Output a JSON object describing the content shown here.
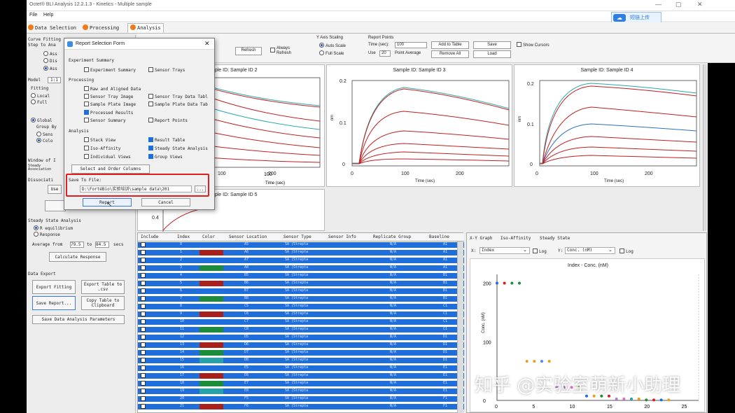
{
  "window": {
    "title": "Octet® BLI Analysis 12.2.1.3 - Kinetics - Multiple sample",
    "controls": [
      "—",
      "▢",
      "✕"
    ]
  },
  "menu": [
    "File",
    "Help"
  ],
  "cloud_button": {
    "label": "短链上传"
  },
  "tabs": [
    "Data Selection",
    "Processing",
    "Analysis"
  ],
  "left_panel": {
    "curve_fitting": "Curve Fitting",
    "step_to_analyze": "Step to Ana",
    "step_options": [
      "Ass",
      "Dis",
      "Ass"
    ],
    "model_label": "Model",
    "model_value": "1:1",
    "fitting_label": "Fitting",
    "fitting_options": [
      "Local",
      "Full"
    ],
    "global_label": "Global",
    "group_by": "Group By",
    "group_options": [
      "Sens",
      "Colo"
    ],
    "window_label": "Window of I",
    "steady_label": "Steady Association",
    "dissociation": "Dissociati",
    "use_btn": "Use",
    "ssa_title": "Steady State Analysis",
    "ssa_options": [
      "R equilibrium",
      "Response"
    ],
    "average_from": "Average from",
    "avg_from_value": "79.5",
    "avg_to_label": "to",
    "avg_to_value": "84.5",
    "avg_unit": "secs",
    "calc_response": "Calculate Response",
    "data_export": "Data Export",
    "export_fitting": "Export Fitting",
    "export_table": "Export Table to .csv",
    "save_report": "Save Report...",
    "copy_table": "Copy Table to Clipboard",
    "save_params": "Save Data Analysis Parameters"
  },
  "toolbar": {
    "refresh": "Refresh",
    "always_refresh": "Always Refresh",
    "y_axis_scaling": "Y Axis Scaling",
    "auto_scale": "Auto Scale",
    "full_scale": "Full Scale",
    "report_points": "Report Points",
    "time_label": "Time (sec):",
    "time_value": "100",
    "use_label": "Use",
    "use_value": "20",
    "point_average": "Point Average",
    "add_to_table": "Add to Table",
    "remove_all": "Remove All",
    "save": "Save",
    "load": "Load",
    "show_cursors": "Show Cursors"
  },
  "graphs": [
    {
      "title": "Sample ID: Sample ID 2",
      "xlabel": "Time (sec)",
      "xticks": [
        "100",
        "200"
      ]
    },
    {
      "title": "Sample ID: Sample ID 3",
      "xlabel": "Time (sec)",
      "xticks": [
        "0",
        "100",
        "200"
      ],
      "yticks": [
        "0.2",
        "0.1",
        "0"
      ],
      "ylabel": "nm"
    },
    {
      "title": "Sample ID: Sample ID 4",
      "xlabel": "Time (sec)",
      "xticks": [
        "0",
        "100",
        "200"
      ],
      "yticks": [
        "0.2",
        "0.1",
        "0"
      ],
      "ylabel": "nm"
    },
    {
      "title": "Sample ID: Sample ID 5",
      "yticks": [
        "0.4"
      ]
    }
  ],
  "dialog": {
    "title": "Report Selection Form",
    "experiment_summary_header": "Experiment Summary",
    "experiment_summary": "Experiment Summary",
    "sensor_trays": "Sensor Trays",
    "processing_header": "Processing",
    "raw_aligned": "Raw and Aligned Data",
    "sensor_tray_image": "Sensor Tray Image",
    "sensor_tray_data": "Sensor Tray Data Tabl",
    "sample_plate_image": "Sample Plate Image",
    "sample_plate_data": "Sample Plate Data Tab",
    "processed_results": "Processed Results",
    "sensor_summary": "Sensor Summary",
    "report_points": "Report Points",
    "analysis_header": "Analysis",
    "stack_view": "Stack View",
    "result_table": "Result Table",
    "iso_affinity": "Iso-Affinity",
    "steady_state": "Steady State Analysis",
    "individual_views": "Individual Views",
    "group_views": "Group Views",
    "select_columns": "Select and Order Columns",
    "save_to_file": "Save To File:",
    "file_path": "D:\\FortéBio\\实验培训\\sample data\\201",
    "browse": "...",
    "report_btn": "Report",
    "cancel_btn": "Cancel"
  },
  "table": {
    "headers": [
      "Include",
      "Index",
      "Color",
      "Sensor Location",
      "Sensor Type",
      "Sensor Info",
      "Replicate Group",
      "Baseline"
    ],
    "rows": [
      {
        "index": "0",
        "loc": "A5",
        "type": "SA (Strepta",
        "rep": "N/A",
        "base": "A1",
        "color": "#1f6ed9"
      },
      {
        "index": "1",
        "loc": "A6",
        "type": "SA (Strepta",
        "rep": "N/A",
        "base": "A1",
        "color": "#a8201c"
      },
      {
        "index": "2",
        "loc": "A7",
        "type": "SA (Strepta",
        "rep": "N/A",
        "base": "A1",
        "color": "#1f6ed9"
      },
      {
        "index": "3",
        "loc": "A8",
        "type": "SA (Strepta",
        "rep": "N/A",
        "base": "A1",
        "color": "#1a8c3a"
      },
      {
        "index": "4",
        "loc": "B5",
        "type": "SA (Strepta",
        "rep": "N/A",
        "base": "B1",
        "color": "#1f6ed9"
      },
      {
        "index": "5",
        "loc": "B6",
        "type": "SA (Strepta",
        "rep": "N/A",
        "base": "B1",
        "color": "#a8201c"
      },
      {
        "index": "6",
        "loc": "B7",
        "type": "SA (Strepta",
        "rep": "N/A",
        "base": "B1",
        "color": "#1f6ed9"
      },
      {
        "index": "7",
        "loc": "B8",
        "type": "SA (Strepta",
        "rep": "N/A",
        "base": "B1",
        "color": "#1a8c3a"
      },
      {
        "index": "8",
        "loc": "C5",
        "type": "SA (Strepta",
        "rep": "N/A",
        "base": "C1",
        "color": "#1f6ed9"
      },
      {
        "index": "9",
        "loc": "C6",
        "type": "SA (Strepta",
        "rep": "N/A",
        "base": "C1",
        "color": "#a8201c"
      },
      {
        "index": "10",
        "loc": "C7",
        "type": "SA (Strepta",
        "rep": "N/A",
        "base": "C1",
        "color": "#1f6ed9"
      },
      {
        "index": "11",
        "loc": "C8",
        "type": "SA (Strepta",
        "rep": "N/A",
        "base": "C1",
        "color": "#1a8c3a"
      },
      {
        "index": "12",
        "loc": "D5",
        "type": "SA (Strepta",
        "rep": "N/A",
        "base": "D1",
        "color": "#1f6ed9"
      },
      {
        "index": "13",
        "loc": "D6",
        "type": "SA (Strepta",
        "rep": "N/A",
        "base": "D1",
        "color": "#a8201c"
      },
      {
        "index": "14",
        "loc": "D7",
        "type": "SA (Strepta",
        "rep": "N/A",
        "base": "D1",
        "color": "#1a8c3a"
      },
      {
        "index": "15",
        "loc": "D8",
        "type": "SA (Strepta",
        "rep": "N/A",
        "base": "D1",
        "color": "#26a3a8"
      },
      {
        "index": "16",
        "loc": "E5",
        "type": "SA (Strepta",
        "rep": "N/A",
        "base": "E1",
        "color": "#1f6ed9"
      },
      {
        "index": "17",
        "loc": "E6",
        "type": "SA (Strepta",
        "rep": "N/A",
        "base": "E1",
        "color": "#a8201c"
      },
      {
        "index": "18",
        "loc": "E7",
        "type": "SA (Strepta",
        "rep": "N/A",
        "base": "E1",
        "color": "#1a8c3a"
      },
      {
        "index": "19",
        "loc": "E8",
        "type": "SA (Strepta",
        "rep": "N/A",
        "base": "E1",
        "color": "#26a3a8"
      },
      {
        "index": "20",
        "loc": "F5",
        "type": "SA (Strepta",
        "rep": "N/A",
        "base": "F1",
        "color": "#1f6ed9"
      },
      {
        "index": "21",
        "loc": "F6",
        "type": "SA (Strepta",
        "rep": "N/A",
        "base": "F1",
        "color": "#a8201c"
      }
    ]
  },
  "xy_panel": {
    "tabs": [
      "X-Y Graph",
      "Iso-Affinity",
      "Steady State"
    ],
    "x_label": "X:",
    "x_value": "Index",
    "log_label": "Log",
    "y_label": "Y:",
    "y_value": "Conc. (nM)",
    "chart_title": "Index - Conc. (nM)",
    "ylabel": "Conc. (nM)"
  },
  "chart_data": {
    "type": "scatter",
    "title": "Index - Conc. (nM)",
    "xlabel": "",
    "ylabel": "Conc. (nM)",
    "xlim": [
      0,
      27
    ],
    "ylim": [
      0,
      215
    ],
    "xticks": [
      "0",
      "5",
      "10",
      "15",
      "20",
      "25"
    ],
    "yticks": [
      "200",
      "100",
      "0"
    ],
    "points": [
      {
        "x": 0,
        "y": 200,
        "color": "#1f6ed9"
      },
      {
        "x": 1,
        "y": 200,
        "color": "#d02020"
      },
      {
        "x": 2,
        "y": 200,
        "color": "#1a8c3a"
      },
      {
        "x": 3,
        "y": 200,
        "color": "#1a8c3a"
      },
      {
        "x": 4,
        "y": 66.7,
        "color": "#e0a020"
      },
      {
        "x": 5,
        "y": 66.7,
        "color": "#e0a020"
      },
      {
        "x": 6,
        "y": 66.7,
        "color": "#4d8fe0"
      },
      {
        "x": 7,
        "y": 66.7,
        "color": "#e0a020"
      },
      {
        "x": 8,
        "y": 22.2,
        "color": "#b080d0"
      },
      {
        "x": 9,
        "y": 22.2,
        "color": "#b080d0"
      },
      {
        "x": 10,
        "y": 22.2,
        "color": "#e070c0"
      },
      {
        "x": 11,
        "y": 22.2,
        "color": "#a0c060"
      },
      {
        "x": 12,
        "y": 7.4,
        "color": "#1f6ed9"
      },
      {
        "x": 13,
        "y": 7.4,
        "color": "#e0a020"
      },
      {
        "x": 14,
        "y": 7.4,
        "color": "#1a8c3a"
      },
      {
        "x": 15,
        "y": 7.4,
        "color": "#d02020"
      },
      {
        "x": 16,
        "y": 2.5,
        "color": "#b080d0"
      },
      {
        "x": 17,
        "y": 2.5,
        "color": "#e070c0"
      },
      {
        "x": 18,
        "y": 2.5,
        "color": "#26a3a8"
      },
      {
        "x": 19,
        "y": 2.5,
        "color": "#e0a020"
      },
      {
        "x": 20,
        "y": 0.8,
        "color": "#1a8c3a"
      },
      {
        "x": 21,
        "y": 0.8,
        "color": "#d02020"
      },
      {
        "x": 22,
        "y": 0.8,
        "color": "#1f6ed9"
      },
      {
        "x": 23,
        "y": 0.8,
        "color": "#e0a020"
      }
    ]
  },
  "watermark": "知乎 @实验室萌新小助理"
}
